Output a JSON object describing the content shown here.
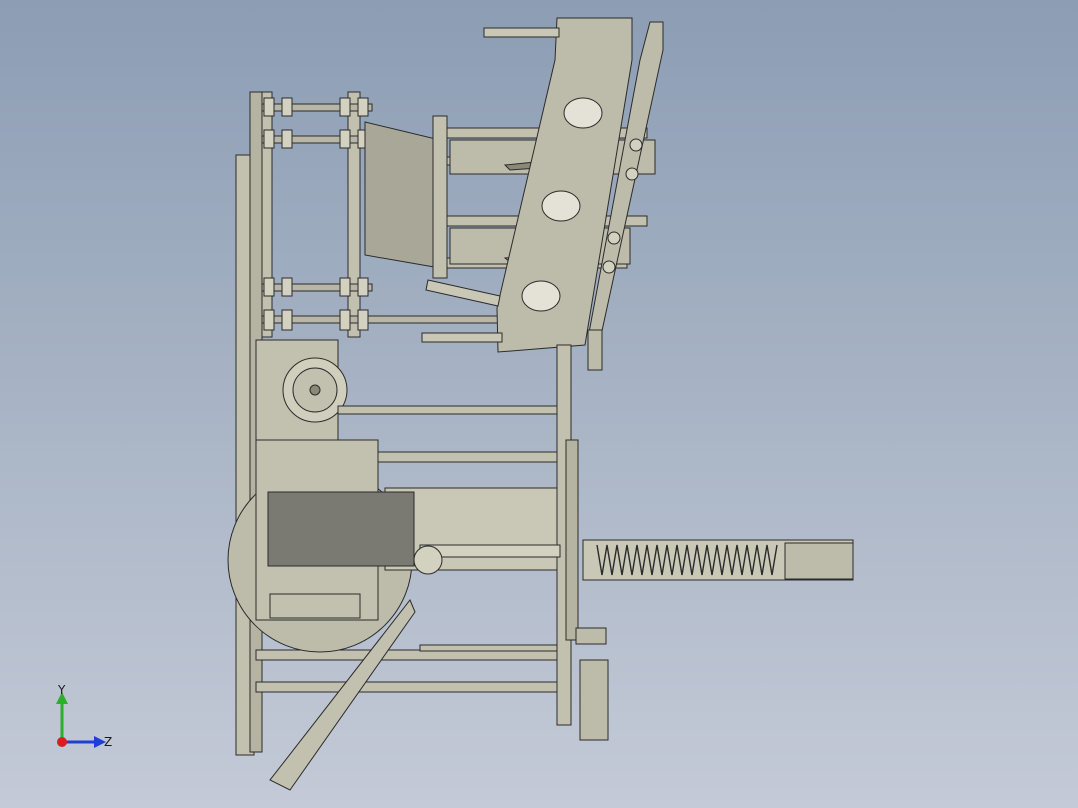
{
  "viewport": {
    "background_top": "#8c9db4",
    "background_bottom": "#c4cad7"
  },
  "model": {
    "part_fill": "#c2c0ae",
    "part_dark": "#8a8878",
    "outline": "#2b2b2b",
    "screen_fill": "#7b7a72"
  },
  "triad": {
    "y_label": "Y",
    "z_label": "Z",
    "y_color": "#2bb02b",
    "z_color": "#1f3fd8",
    "x_color": "#d81f1f"
  }
}
